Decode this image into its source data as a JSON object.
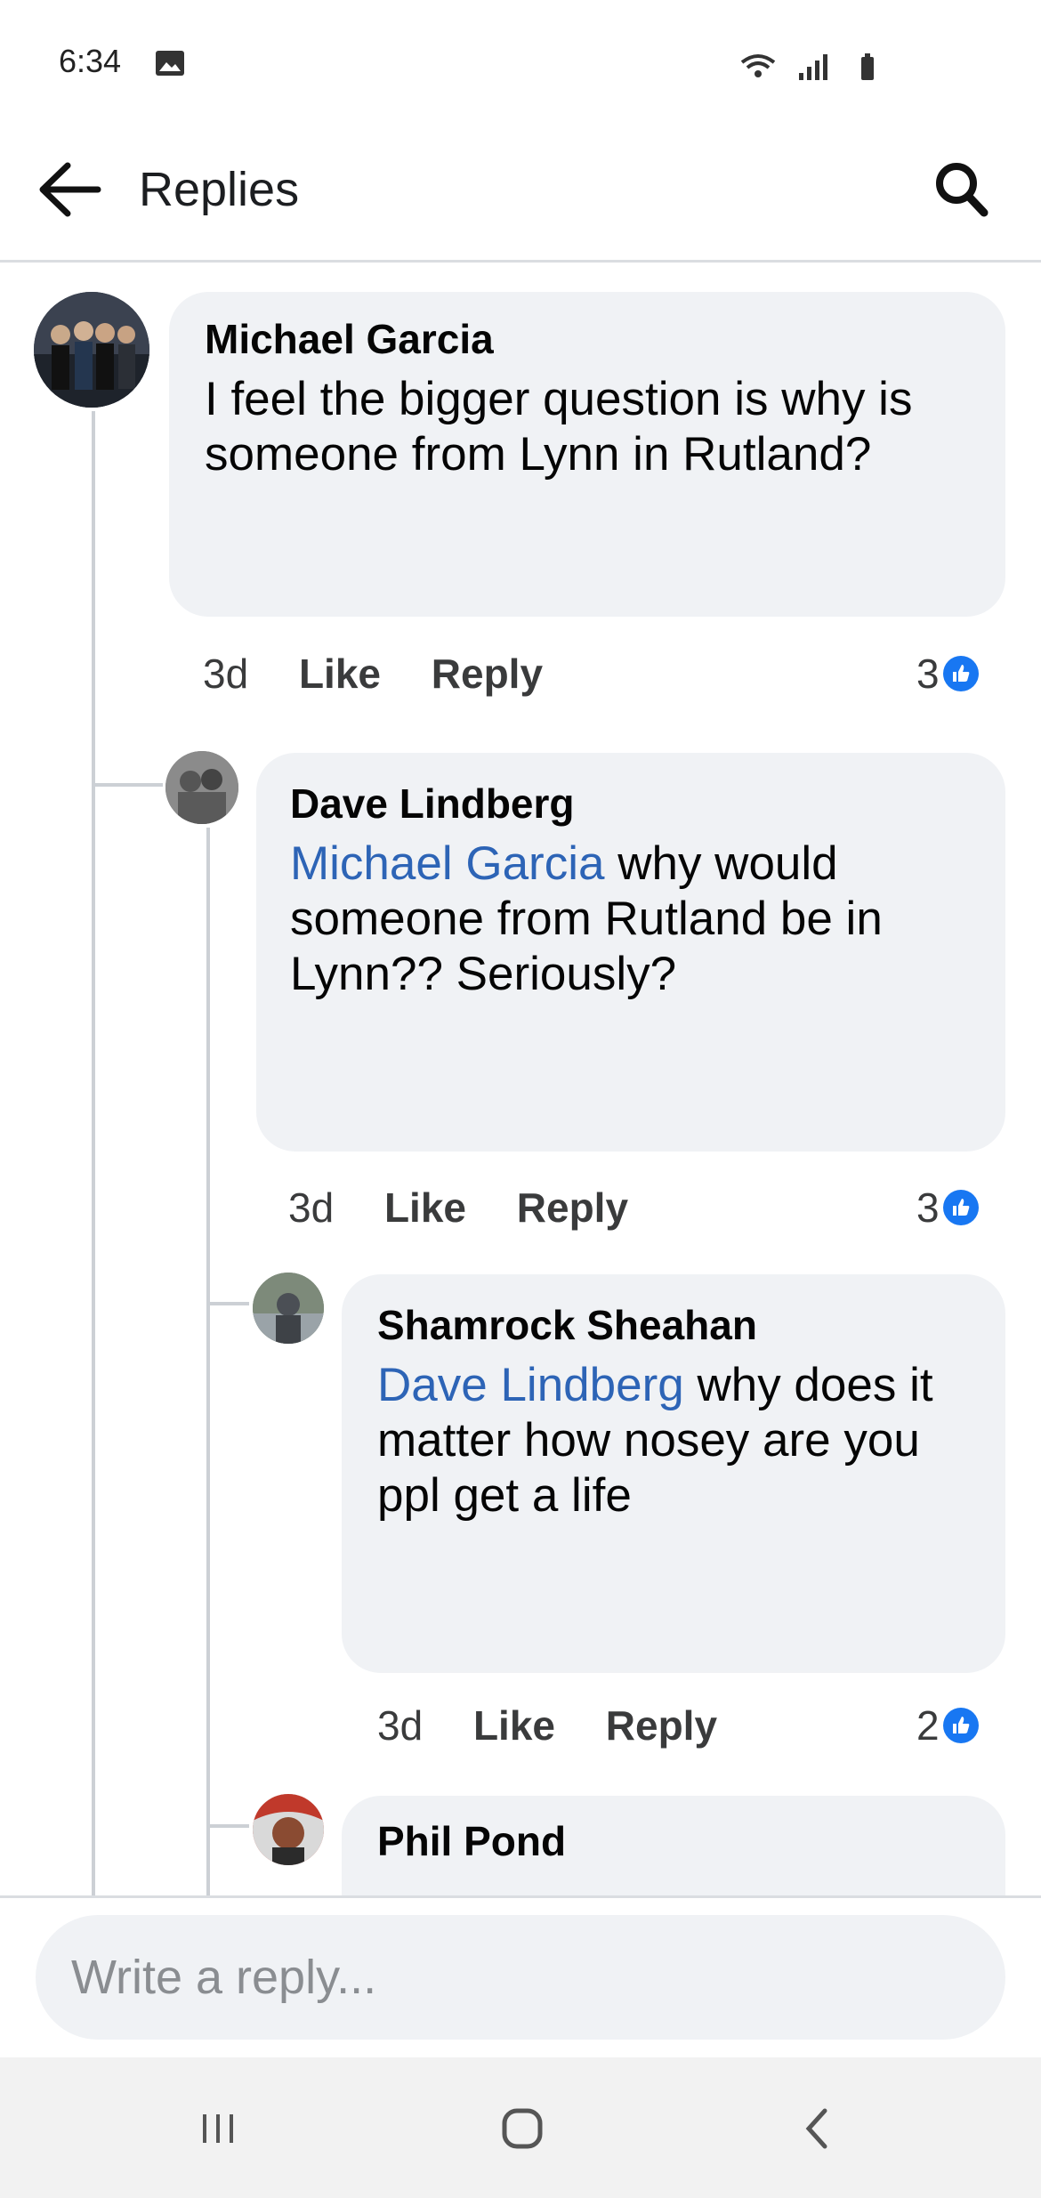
{
  "status_bar": {
    "time": "6:34"
  },
  "header": {
    "title": "Replies"
  },
  "comments": [
    {
      "author": "Michael Garcia",
      "mention": "",
      "text": "I feel the bigger question is why is someone from Lynn in Rutland?",
      "time": "3d",
      "like_label": "Like",
      "reply_label": "Reply",
      "reaction_count": "3"
    },
    {
      "author": "Dave Lindberg",
      "mention": "Michael Garcia",
      "text": " why would someone from Rutland be in Lynn?? Seriously?",
      "time": "3d",
      "like_label": "Like",
      "reply_label": "Reply",
      "reaction_count": "3"
    },
    {
      "author": "Shamrock Sheahan",
      "mention": "Dave Lindberg",
      "text": " why does it matter how nosey are you ppl get a life",
      "time": "3d",
      "like_label": "Like",
      "reply_label": "Reply",
      "reaction_count": "2"
    },
    {
      "author": "Phil Pond"
    }
  ],
  "composer": {
    "placeholder": "Write a reply..."
  },
  "icons": {
    "back": "arrow-left-icon",
    "search": "search-icon",
    "reaction": "thumbs-up-icon",
    "nav_recents": "recent-apps-icon",
    "nav_home": "home-icon",
    "nav_back": "chevron-left-icon"
  },
  "colors": {
    "bubble": "#f0f2f5",
    "mention": "#2d64b6",
    "like_badge": "#1877f2",
    "thread_line": "#ccd0d5"
  }
}
